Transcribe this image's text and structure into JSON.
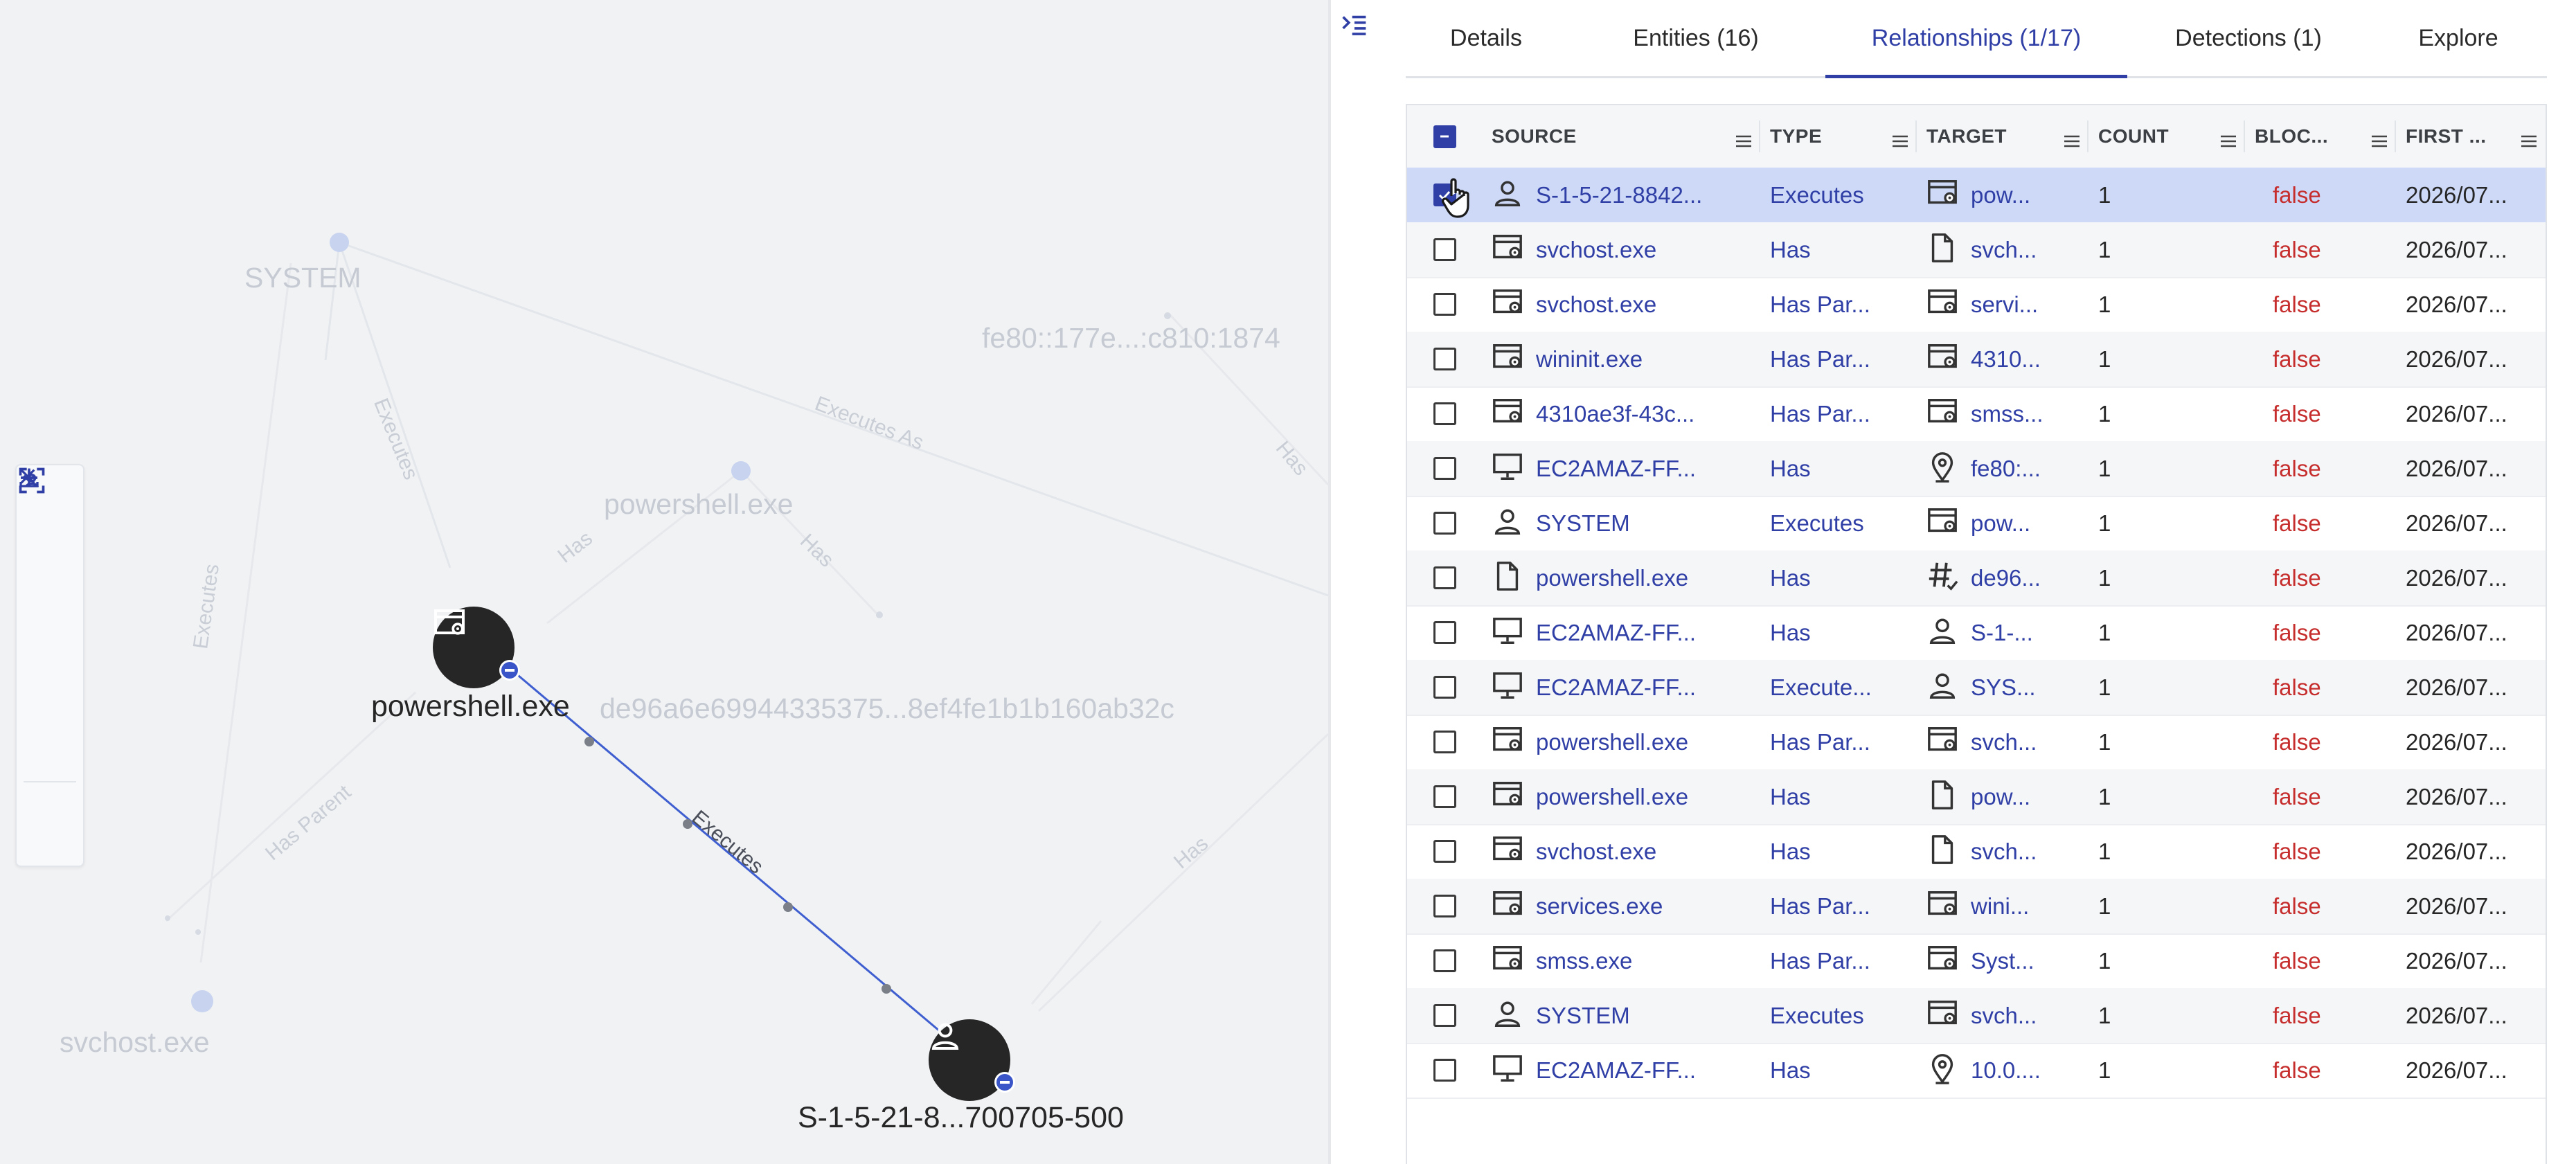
{
  "graph": {
    "nodes": {
      "powershell_main": "powershell.exe",
      "user_main": "S-1-5-21-8...700705-500"
    },
    "active_edge_label": "Executes",
    "faded_labels": {
      "system": "SYSTEM",
      "ipv6": "fe80::177e...:c810:1874",
      "powershell": "powershell.exe",
      "hash": "de96a6e69944335375...8ef4fe1b1b160ab32c",
      "svchost": "svchost.exe"
    },
    "faded_edge_labels": {
      "e1": "Executes",
      "e2": "Executes As",
      "e3": "Has",
      "e4": "Executes",
      "e5": "Has",
      "e6": "Has",
      "e7": "Has Parent",
      "e8": "Has"
    },
    "zoom_controls": [
      "zoom-in",
      "zoom-out",
      "fit-to-screen",
      "download",
      "close"
    ]
  },
  "tabs": [
    {
      "label": "Details"
    },
    {
      "label": "Entities  (16)"
    },
    {
      "label": "Relationships  (1/17)",
      "active": true
    },
    {
      "label": "Detections  (1)"
    },
    {
      "label": "Explore"
    }
  ],
  "table": {
    "columns": [
      "SOURCE",
      "TYPE",
      "TARGET",
      "COUNT",
      "BLOC...",
      "FIRST ..."
    ],
    "rows": [
      {
        "source_icon": "user-icon",
        "source": "S-1-5-21-8842...",
        "type": "Executes",
        "target_icon": "process-icon",
        "target": "pow...",
        "count": "1",
        "blocked": "false",
        "first": "2026/07...",
        "checked": true
      },
      {
        "source_icon": "process-icon",
        "source": "svchost.exe",
        "type": "Has",
        "target_icon": "file-icon",
        "target": "svch...",
        "count": "1",
        "blocked": "false",
        "first": "2026/07..."
      },
      {
        "source_icon": "process-icon",
        "source": "svchost.exe",
        "type": "Has Par...",
        "target_icon": "process-icon",
        "target": "servi...",
        "count": "1",
        "blocked": "false",
        "first": "2026/07..."
      },
      {
        "source_icon": "process-icon",
        "source": "wininit.exe",
        "type": "Has Par...",
        "target_icon": "process-icon",
        "target": "4310...",
        "count": "1",
        "blocked": "false",
        "first": "2026/07..."
      },
      {
        "source_icon": "process-icon",
        "source": "4310ae3f-43c...",
        "type": "Has Par...",
        "target_icon": "process-icon",
        "target": "smss...",
        "count": "1",
        "blocked": "false",
        "first": "2026/07..."
      },
      {
        "source_icon": "monitor-icon",
        "source": "EC2AMAZ-FF...",
        "type": "Has",
        "target_icon": "location-icon",
        "target": "fe80:...",
        "count": "1",
        "blocked": "false",
        "first": "2026/07..."
      },
      {
        "source_icon": "user-icon",
        "source": "SYSTEM",
        "type": "Executes",
        "target_icon": "process-icon",
        "target": "pow...",
        "count": "1",
        "blocked": "false",
        "first": "2026/07..."
      },
      {
        "source_icon": "file-icon",
        "source": "powershell.exe",
        "type": "Has",
        "target_icon": "hash-icon",
        "target": "de96...",
        "count": "1",
        "blocked": "false",
        "first": "2026/07..."
      },
      {
        "source_icon": "monitor-icon",
        "source": "EC2AMAZ-FF...",
        "type": "Has",
        "target_icon": "user-icon",
        "target": "S-1-...",
        "count": "1",
        "blocked": "false",
        "first": "2026/07..."
      },
      {
        "source_icon": "monitor-icon",
        "source": "EC2AMAZ-FF...",
        "type": "Execute...",
        "target_icon": "user-icon",
        "target": "SYS...",
        "count": "1",
        "blocked": "false",
        "first": "2026/07..."
      },
      {
        "source_icon": "process-icon",
        "source": "powershell.exe",
        "type": "Has Par...",
        "target_icon": "process-icon",
        "target": "svch...",
        "count": "1",
        "blocked": "false",
        "first": "2026/07..."
      },
      {
        "source_icon": "process-icon",
        "source": "powershell.exe",
        "type": "Has",
        "target_icon": "file-icon",
        "target": "pow...",
        "count": "1",
        "blocked": "false",
        "first": "2026/07..."
      },
      {
        "source_icon": "process-icon",
        "source": "svchost.exe",
        "type": "Has",
        "target_icon": "file-icon",
        "target": "svch...",
        "count": "1",
        "blocked": "false",
        "first": "2026/07..."
      },
      {
        "source_icon": "process-icon",
        "source": "services.exe",
        "type": "Has Par...",
        "target_icon": "process-icon",
        "target": "wini...",
        "count": "1",
        "blocked": "false",
        "first": "2026/07..."
      },
      {
        "source_icon": "process-icon",
        "source": "smss.exe",
        "type": "Has Par...",
        "target_icon": "process-icon",
        "target": "Syst...",
        "count": "1",
        "blocked": "false",
        "first": "2026/07..."
      },
      {
        "source_icon": "user-icon",
        "source": "SYSTEM",
        "type": "Executes",
        "target_icon": "process-icon",
        "target": "svch...",
        "count": "1",
        "blocked": "false",
        "first": "2026/07..."
      },
      {
        "source_icon": "monitor-icon",
        "source": "EC2AMAZ-FF...",
        "type": "Has",
        "target_icon": "location-icon",
        "target": "10.0....",
        "count": "1",
        "blocked": "false",
        "first": "2026/07..."
      }
    ]
  },
  "colors": {
    "accent": "#2f3fa6",
    "selected_row": "#cdd9f7",
    "false_text": "#c62d2d",
    "graph_bg": "#f1f2f4",
    "node_dark": "#262626"
  }
}
